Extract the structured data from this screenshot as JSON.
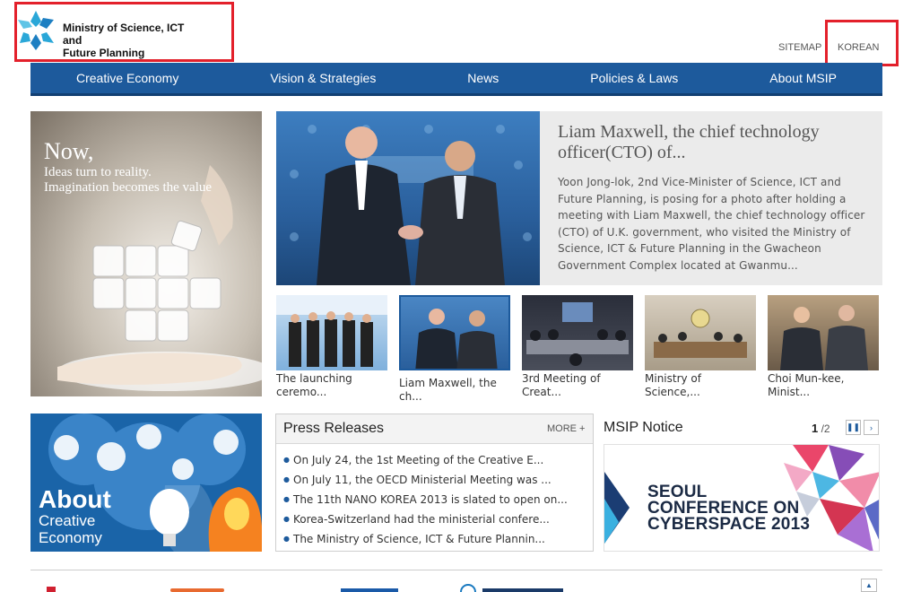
{
  "header": {
    "logo_line1": "Ministry of Science, ICT and",
    "logo_line2": "Future Planning",
    "sitemap": "SITEMAP",
    "korean": "KOREAN"
  },
  "nav": [
    "Creative Economy",
    "Vision & Strategies",
    "News",
    "Policies & Laws",
    "About MSIP"
  ],
  "banner": {
    "now": "Now,",
    "line1": "Ideas turn to reality.",
    "line2": "Imagination becomes the value"
  },
  "feature": {
    "title": "Liam Maxwell, the chief technology officer(CTO) of...",
    "body": "Yoon Jong-lok, 2nd Vice-Minister of Science, ICT and Future Planning, is posing for a photo after holding a meeting with Liam Maxwell, the chief technology officer (CTO) of U.K. government, who visited the Ministry of Science, ICT & Future Planning in the Gwacheon Government Complex located at Gwanmu..."
  },
  "thumbs": [
    {
      "cap1": "The launching",
      "cap2": "ceremo..."
    },
    {
      "cap1": "Liam Maxwell, the",
      "cap2": "ch..."
    },
    {
      "cap1": "3rd Meeting of",
      "cap2": "Creat..."
    },
    {
      "cap1": "Ministry of Science,...",
      "cap2": ""
    },
    {
      "cap1": "Choi Mun-kee,",
      "cap2": "Minist..."
    }
  ],
  "about": {
    "line1": "About",
    "line2": "Creative",
    "line3": "Economy"
  },
  "press": {
    "title": "Press Releases",
    "more": "MORE +",
    "items": [
      "On July 24, the 1st Meeting of the Creative E...",
      "On July 11, the OECD Ministerial Meeting was ...",
      "The 11th NANO KOREA 2013 is slated to open on...",
      "Korea-Switzerland had the ministerial confere...",
      "The Ministry of Science, ICT & Future Plannin..."
    ]
  },
  "notice": {
    "title": "MSIP Notice",
    "page_current": "1",
    "page_total": "/2",
    "pause_icon": "pause-icon",
    "next_icon": "next-icon",
    "seoul_1": "SEOUL",
    "seoul_2": "CONFERENCE ON",
    "seoul_3": "CYBERSPACE 2013"
  },
  "colors": {
    "nav_blue": "#1d5a9c",
    "highlight_red": "#e3202b"
  }
}
